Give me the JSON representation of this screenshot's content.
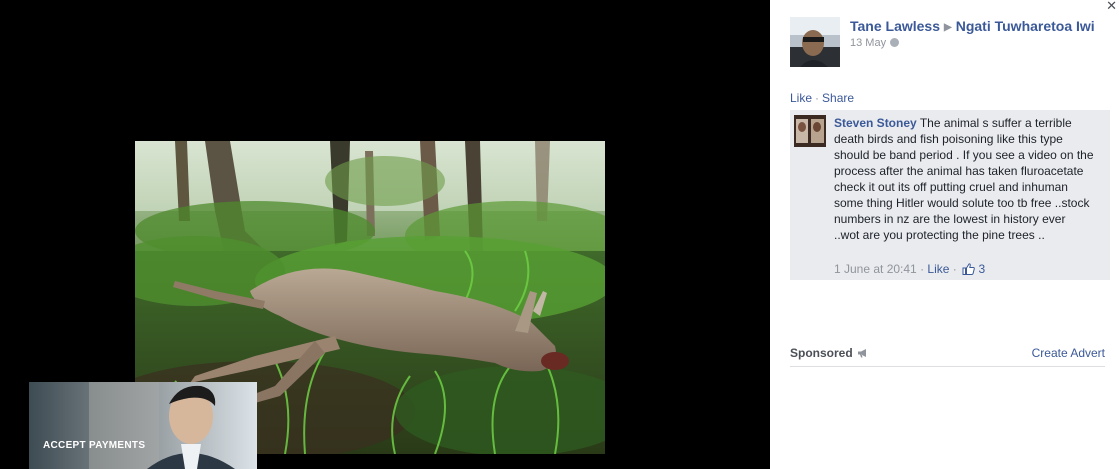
{
  "post": {
    "author": "Tane Lawless",
    "target_group": "Ngati Tuwharetoa Iwi",
    "date": "13 May",
    "actions": {
      "like": "Like",
      "share": "Share"
    }
  },
  "comment": {
    "author": "Steven Stoney",
    "text": "The animal s suffer a terrible death birds and fish poisoning like this type should be band period . If you see a video on the process after the animal has taken fluroacetate check it out its off putting cruel and inhuman some thing Hitler would solute too tb free ..stock numbers in nz are the lowest in history ever ..wot are you protecting the pine trees ..",
    "timestamp": "1 June at 20:41",
    "like_label": "Like",
    "like_count": "3"
  },
  "sponsored": {
    "label": "Sponsored",
    "create_advert": "Create Advert",
    "ad_text": "ACCEPT PAYMENTS"
  },
  "icons": {
    "close": "close-icon",
    "arrow": "right-triangle-icon",
    "privacy": "globe-icon",
    "thumbs_up": "thumbs-up-icon",
    "sponsored": "megaphone-icon"
  },
  "colors": {
    "link": "#3b5998",
    "meta": "#90949c",
    "comment_bg": "#e9ebee",
    "viewer_bg": "#000000"
  }
}
